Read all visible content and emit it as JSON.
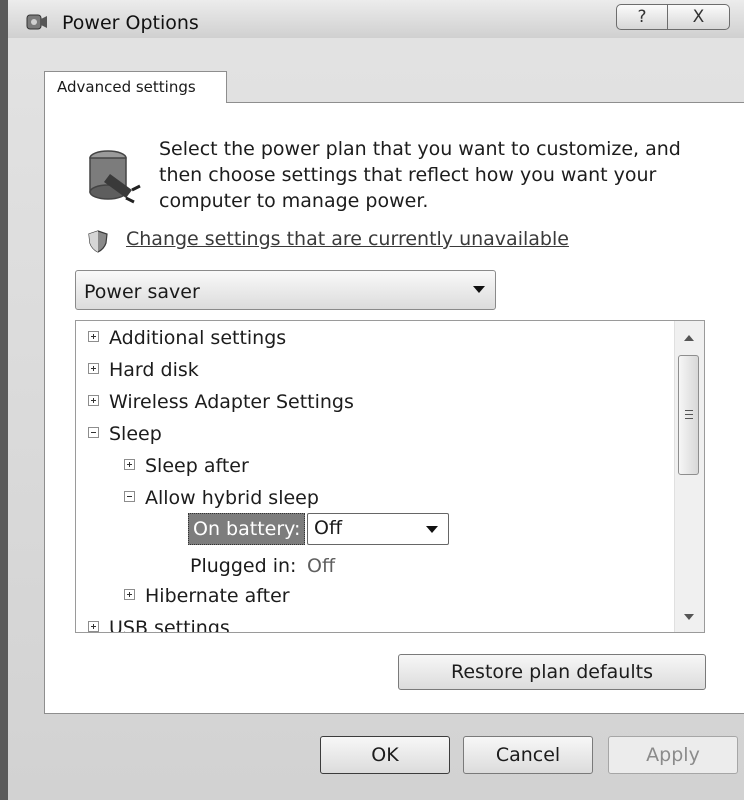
{
  "window": {
    "title": "Power Options",
    "help_label": "?",
    "close_label": "X"
  },
  "tab": {
    "label": "Advanced settings"
  },
  "intro": {
    "text": "Select the power plan that you want to customize, and then choose settings that reflect how you want your computer to manage power."
  },
  "change_link": "Change settings that are currently unavailable",
  "plan_select": {
    "value": "Power saver"
  },
  "tree": {
    "items": [
      {
        "label": "Additional settings",
        "expanded": false
      },
      {
        "label": "Hard disk",
        "expanded": false
      },
      {
        "label": "Wireless Adapter Settings",
        "expanded": false
      },
      {
        "label": "Sleep",
        "expanded": true
      },
      {
        "label": "Sleep after",
        "expanded": false
      },
      {
        "label": "Allow hybrid sleep",
        "expanded": true
      },
      {
        "label": "Hibernate after",
        "expanded": false
      },
      {
        "label": "USB settings",
        "expanded": false
      }
    ],
    "on_battery_label": "On battery:",
    "on_battery_value": "Off",
    "plugged_in_label": "Plugged in:",
    "plugged_in_value": "Off"
  },
  "buttons": {
    "restore": "Restore plan defaults",
    "ok": "OK",
    "cancel": "Cancel",
    "apply": "Apply"
  },
  "colors": {
    "window_border": "#5a5a5a",
    "selection": "#7d7d7d",
    "disabled_text": "#8b8b8b"
  }
}
